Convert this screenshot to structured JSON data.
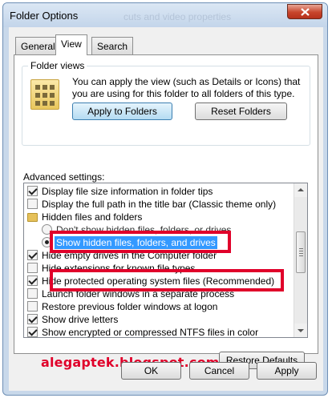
{
  "window": {
    "title": "Folder Options",
    "ghost_text": "cuts and video properties"
  },
  "tabs": [
    {
      "label": "General",
      "active": false
    },
    {
      "label": "View",
      "active": true
    },
    {
      "label": "Search",
      "active": false
    }
  ],
  "folder_views": {
    "label": "Folder views",
    "description": "You can apply the view (such as Details or Icons) that you are using for this folder to all folders of this type.",
    "apply_button": "Apply to Folders",
    "reset_button": "Reset Folders"
  },
  "advanced": {
    "label": "Advanced settings:",
    "items": [
      {
        "type": "checkbox",
        "checked": true,
        "label": "Display file size information in folder tips"
      },
      {
        "type": "checkbox",
        "checked": false,
        "label": "Display the full path in the title bar (Classic theme only)"
      },
      {
        "type": "folder",
        "label": "Hidden files and folders"
      },
      {
        "type": "radio",
        "checked": false,
        "label": "Don't show hidden files, folders, or drives"
      },
      {
        "type": "radio",
        "checked": true,
        "label": "Show hidden files, folders, and drives"
      },
      {
        "type": "checkbox",
        "checked": true,
        "label": "Hide empty drives in the Computer folder"
      },
      {
        "type": "checkbox",
        "checked": false,
        "label": "Hide extensions for known file types"
      },
      {
        "type": "checkbox",
        "checked": true,
        "label": "Hide protected operating system files (Recommended)"
      },
      {
        "type": "checkbox",
        "checked": false,
        "label": "Launch folder windows in a separate process"
      },
      {
        "type": "checkbox",
        "checked": false,
        "label": "Restore previous folder windows at logon"
      },
      {
        "type": "checkbox",
        "checked": true,
        "label": "Show drive letters"
      },
      {
        "type": "checkbox",
        "checked": true,
        "label": "Show encrypted or compressed NTFS files in color"
      }
    ]
  },
  "watermark": "alegaptek.blogspot.com",
  "restore_button": "Restore Defaults",
  "dialog_buttons": {
    "ok": "OK",
    "cancel": "Cancel",
    "apply": "Apply"
  },
  "colors": {
    "highlight": "#e0002a",
    "selection": "#3399ff"
  }
}
